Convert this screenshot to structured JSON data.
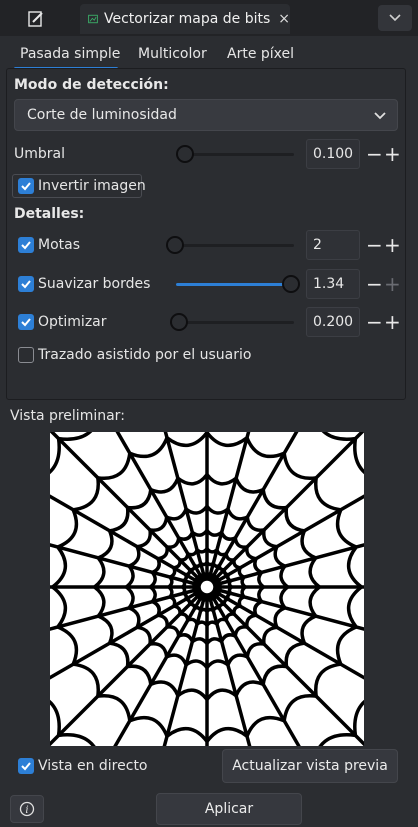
{
  "tabs": {
    "active_title": "Vectorizar mapa de bits",
    "close_symbol": "×"
  },
  "subtabs": [
    "Pasada simple",
    "Multicolor",
    "Arte píxel"
  ],
  "detection": {
    "heading": "Modo de detección:",
    "mode_value": "Corte de luminosidad",
    "threshold_label": "Umbral",
    "threshold_value": "0.100",
    "threshold_level": 0.1,
    "invert_label": "Invertir imagen",
    "invert_checked": true
  },
  "details": {
    "heading": "Detalles:",
    "speckles": {
      "label": "Motas",
      "value": "2",
      "checked": true,
      "level": 0.0
    },
    "smooth": {
      "label": "Suavizar bordes",
      "value": "1.34",
      "checked": true,
      "level": 1.0
    },
    "optimize": {
      "label": "Optimizar",
      "value": "0.200",
      "checked": true,
      "level": 0.0
    },
    "assisted": {
      "label": "Trazado asistido por el usuario",
      "checked": false
    }
  },
  "preview": {
    "label": "Vista preliminar:",
    "live_label": "Vista en directo",
    "live_checked": true,
    "update_button": "Actualizar vista previa"
  },
  "footer": {
    "apply_button": "Aplicar",
    "info_icon": "info-icon"
  },
  "signs": {
    "minus": "−",
    "plus": "+"
  },
  "colors": {
    "accent": "#2d7fd6",
    "background": "#2b2d31"
  }
}
